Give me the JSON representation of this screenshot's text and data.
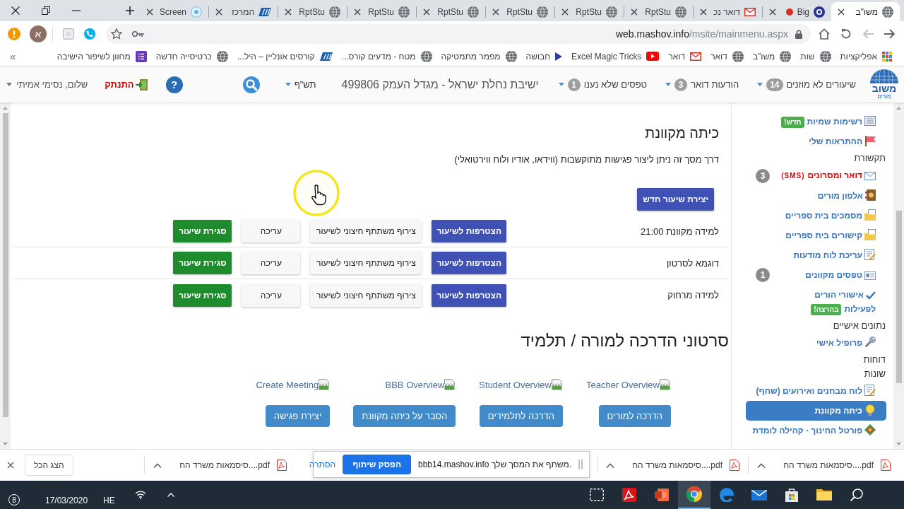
{
  "browser": {
    "tabs": [
      {
        "title": "משו\"ב",
        "selected": true,
        "recording": false
      },
      {
        "title": "Big",
        "selected": false,
        "recording": true
      },
      {
        "title": "דואר נכ",
        "selected": false,
        "recording": false
      },
      {
        "title": "RptStu",
        "selected": false,
        "recording": false
      },
      {
        "title": "RptStu",
        "selected": false,
        "recording": false
      },
      {
        "title": "RptStu",
        "selected": false,
        "recording": false
      },
      {
        "title": "RptStu",
        "selected": false,
        "recording": false
      },
      {
        "title": "RptStu",
        "selected": false,
        "recording": false
      },
      {
        "title": "RptStu",
        "selected": false,
        "recording": false
      },
      {
        "title": "המרכז",
        "selected": false,
        "recording": false
      },
      {
        "title": "Screen",
        "selected": false,
        "recording": false
      }
    ],
    "nav": [
      {
        "disabled": false
      },
      {
        "disabled": true
      },
      {
        "disabled": false
      },
      {
        "disabled": false
      }
    ],
    "address": {
      "host": "web.mashov.info",
      "path": "/msite/mainmenu.aspx"
    },
    "profile": {
      "initial": "א"
    },
    "bookmarks": [
      "אפליקציות",
      "שות",
      "משו\"ב",
      "דואר",
      "דואר",
      "Excel Magic Tricks",
      "חבושה",
      "מפמר מתמטיקה",
      "מטח - מדעים קורס...",
      "קורסים אונליין – היל...",
      "כרטיסייה חדשה",
      "מחוון לשיפור הישיבה"
    ],
    "bookmarks_more": "»"
  },
  "header": {
    "logo": {
      "title": "משוב",
      "subtitle": "מורים"
    },
    "menus": [
      {
        "label": "שיעורים לא מוזנים",
        "count": "14"
      },
      {
        "label": "הודעות דואר",
        "count": "3"
      },
      {
        "label": "טפסים שלא נענו",
        "count": "1"
      }
    ],
    "school": "ישיבת נחלת ישראל - מגדל העמק 499806",
    "year": "תש\"ף",
    "help": "?",
    "logout": "התנתק",
    "greeting": "שלום, נסימי אמיתי"
  },
  "main": {
    "title": "כיתה מקוונת",
    "description": "דרך מסך זה ניתן ליצור פגישות מתוקשבות (ווידאו, אודיו ולוח ווירטואלי)",
    "new_button": "יצירת שיעור חדש",
    "lessons": [
      {
        "name": "למידה מקוונת 21:00",
        "actions": [
          {
            "kind": "join",
            "label": "הצטרפות לשיעור"
          },
          {
            "kind": "invite",
            "label": "צירוף משתתף חיצוני לשיעור"
          },
          {
            "kind": "edit",
            "label": "עריכה"
          },
          {
            "kind": "close",
            "label": "סגירת שיעור"
          }
        ]
      },
      {
        "name": "דוגמא לסרטון",
        "actions": [
          {
            "kind": "join",
            "label": "הצטרפות לשיעור"
          },
          {
            "kind": "invite",
            "label": "צירוף משתתף חיצוני לשיעור"
          },
          {
            "kind": "edit",
            "label": "עריכה"
          },
          {
            "kind": "close",
            "label": "סגירת שיעור"
          }
        ]
      },
      {
        "name": "למידה מרחוק",
        "actions": [
          {
            "kind": "join",
            "label": "הצטרפות לשיעור"
          },
          {
            "kind": "invite",
            "label": "צירוף משתתף חיצוני לשיעור"
          },
          {
            "kind": "edit",
            "label": "עריכה"
          },
          {
            "kind": "close",
            "label": "סגירת שיעור"
          }
        ]
      }
    ],
    "guides_title": "סרטוני הדרכה למורה / תלמיד",
    "guides": [
      {
        "link": "Teacher Overview",
        "button": "הדרכה למורים"
      },
      {
        "link": "Student Overview",
        "button": "הדרכה לתלמידים"
      },
      {
        "link": "BBB Overview",
        "button": "הסבר על כיתה מקוונת"
      },
      {
        "link": "Create Meeting",
        "button": "יצירת פגישה"
      }
    ]
  },
  "sidebar": {
    "items": [
      {
        "kind": "link",
        "label": "רשימות שמיות",
        "tag": "חדש!",
        "selected": false
      },
      {
        "kind": "link",
        "label": "ההתראות שלי",
        "selected": false
      },
      {
        "kind": "heading",
        "label": "תקשורת"
      },
      {
        "kind": "alert",
        "label": "דואר ומסרונים",
        "note": "(SMS)",
        "count": "3",
        "selected": false
      },
      {
        "kind": "link",
        "label": "אלפון מורים",
        "selected": false
      },
      {
        "kind": "link",
        "label": "מסמכים בית ספריים",
        "selected": false
      },
      {
        "kind": "link",
        "label": "קישורים בית ספריים",
        "selected": false
      },
      {
        "kind": "link",
        "label": "עריכת לוח מודעות",
        "selected": false
      },
      {
        "kind": "link",
        "label": "טפסים מקוונים",
        "count": "1",
        "selected": false
      },
      {
        "kind": "link",
        "label": "אישורי הורים לפעילות",
        "tag": "בהרצה!",
        "selected": false
      },
      {
        "kind": "heading",
        "label": "נתונים אישיים"
      },
      {
        "kind": "link",
        "label": "פרופיל אישי",
        "selected": false
      },
      {
        "kind": "heading",
        "label": "דוחות"
      },
      {
        "kind": "heading",
        "label": "שונות"
      },
      {
        "kind": "link",
        "label": "לוח מבחנים ואירועים (שחף)",
        "selected": false
      },
      {
        "kind": "link",
        "label": "כיתה מקוונת",
        "selected": true
      },
      {
        "kind": "link",
        "label": "פורטל החינוך - קהילה לומדת",
        "selected": false
      }
    ]
  },
  "downloads": {
    "items": [
      "סיסמאות משרד הח....pdf",
      "סיסמאות משרד הח....pdf",
      "סיסמאות משרד הח....pdf"
    ],
    "show_all": "הצג הכל"
  },
  "share_bar": {
    "message": "bbb14.mashov.info משתף את המסך שלך.",
    "stop_button": "הפסק שיתוף",
    "hide_link": "הסתרה"
  },
  "taskbar": {
    "apps": [
      {
        "selected": false
      },
      {
        "selected": false
      },
      {
        "selected": false
      },
      {
        "selected": false
      },
      {
        "selected": false
      },
      {
        "selected": true
      },
      {
        "selected": false
      },
      {
        "selected": false
      },
      {
        "selected": false
      }
    ],
    "notifications": "8",
    "language": "HE",
    "date": "17/03/2020"
  }
}
